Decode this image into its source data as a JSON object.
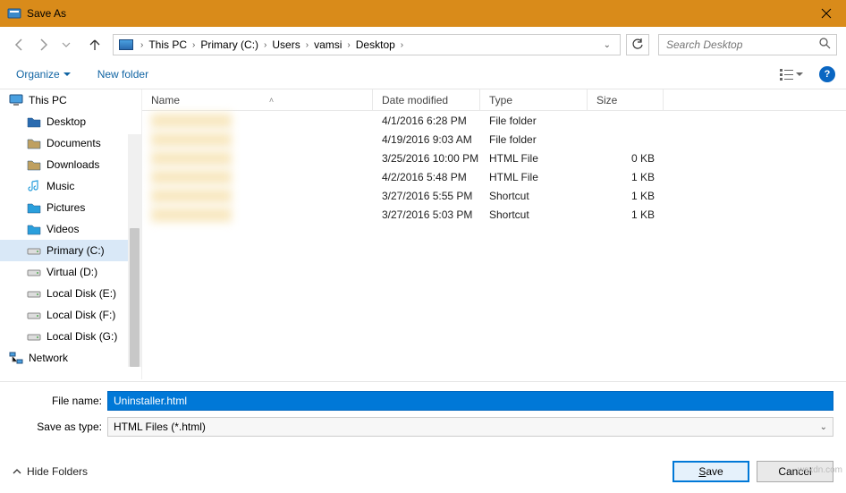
{
  "title": "Save As",
  "breadcrumbs": [
    "This PC",
    "Primary (C:)",
    "Users",
    "vamsi",
    "Desktop"
  ],
  "search": {
    "placeholder": "Search Desktop"
  },
  "toolbar": {
    "organize": "Organize",
    "newfolder": "New folder"
  },
  "sidebar": {
    "items": [
      {
        "label": "This PC",
        "kind": "pc",
        "child": false,
        "selected": false
      },
      {
        "label": "Desktop",
        "kind": "folder-blue",
        "child": true,
        "selected": false
      },
      {
        "label": "Documents",
        "kind": "documents",
        "child": true,
        "selected": false
      },
      {
        "label": "Downloads",
        "kind": "downloads",
        "child": true,
        "selected": false
      },
      {
        "label": "Music",
        "kind": "music",
        "child": true,
        "selected": false
      },
      {
        "label": "Pictures",
        "kind": "pictures",
        "child": true,
        "selected": false
      },
      {
        "label": "Videos",
        "kind": "videos",
        "child": true,
        "selected": false
      },
      {
        "label": "Primary (C:)",
        "kind": "drive",
        "child": true,
        "selected": true
      },
      {
        "label": "Virtual (D:)",
        "kind": "drive",
        "child": true,
        "selected": false
      },
      {
        "label": "Local Disk (E:)",
        "kind": "drive",
        "child": true,
        "selected": false
      },
      {
        "label": "Local Disk (F:)",
        "kind": "drive",
        "child": true,
        "selected": false
      },
      {
        "label": "Local Disk (G:)",
        "kind": "drive",
        "child": true,
        "selected": false
      },
      {
        "label": "Network",
        "kind": "network",
        "child": false,
        "selected": false
      }
    ]
  },
  "columns": {
    "name": "Name",
    "date": "Date modified",
    "type": "Type",
    "size": "Size"
  },
  "rows": [
    {
      "date": "4/1/2016 6:28 PM",
      "type": "File folder",
      "size": ""
    },
    {
      "date": "4/19/2016 9:03 AM",
      "type": "File folder",
      "size": ""
    },
    {
      "date": "3/25/2016 10:00 PM",
      "type": "HTML File",
      "size": "0 KB"
    },
    {
      "date": "4/2/2016 5:48 PM",
      "type": "HTML File",
      "size": "1 KB"
    },
    {
      "date": "3/27/2016 5:55 PM",
      "type": "Shortcut",
      "size": "1 KB"
    },
    {
      "date": "3/27/2016 5:03 PM",
      "type": "Shortcut",
      "size": "1 KB"
    }
  ],
  "form": {
    "filename_label": "File name:",
    "filename_value": "Uninstaller.html",
    "type_label": "Save as type:",
    "type_value": "HTML Files (*.html)"
  },
  "footer": {
    "hide": "Hide Folders",
    "save": "Save",
    "cancel": "Cancel"
  },
  "watermark": "wsxdn.com"
}
